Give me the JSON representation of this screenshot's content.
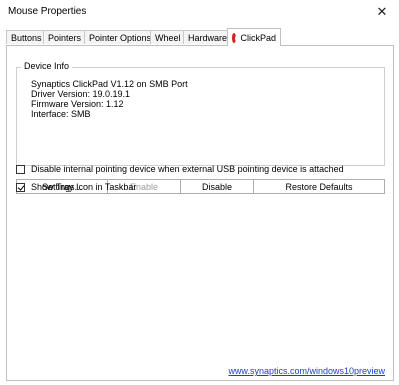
{
  "window": {
    "title": "Mouse Properties",
    "close_label": "✕"
  },
  "tabs": [
    {
      "label": "Buttons"
    },
    {
      "label": "Pointers"
    },
    {
      "label": "Pointer Options"
    },
    {
      "label": "Wheel"
    },
    {
      "label": "Hardware"
    },
    {
      "label": "ClickPad",
      "active": true
    }
  ],
  "device_info": {
    "legend": "Device Info",
    "lines": [
      "Synaptics ClickPad V1.12 on SMB Port",
      "Driver Version: 19.0.19.1",
      "Firmware Version: 1.12",
      "Interface: SMB"
    ]
  },
  "buttons": {
    "settings": "Settings...",
    "enable": "Enable",
    "disable": "Disable",
    "restore": "Restore Defaults"
  },
  "options": {
    "disable_internal": {
      "label": "Disable internal pointing device when external USB pointing device is attached",
      "checked": false
    },
    "show_tray": {
      "label": "Show Tray Icon in Taskbar",
      "checked": true
    }
  },
  "footer": {
    "link": "www.synaptics.com/windows10preview"
  },
  "colors": {
    "link": "#1a3fc6",
    "logo": "#d8232a"
  },
  "icons": {
    "close": "close-icon",
    "clickpad": "clickpad-logo-icon"
  }
}
